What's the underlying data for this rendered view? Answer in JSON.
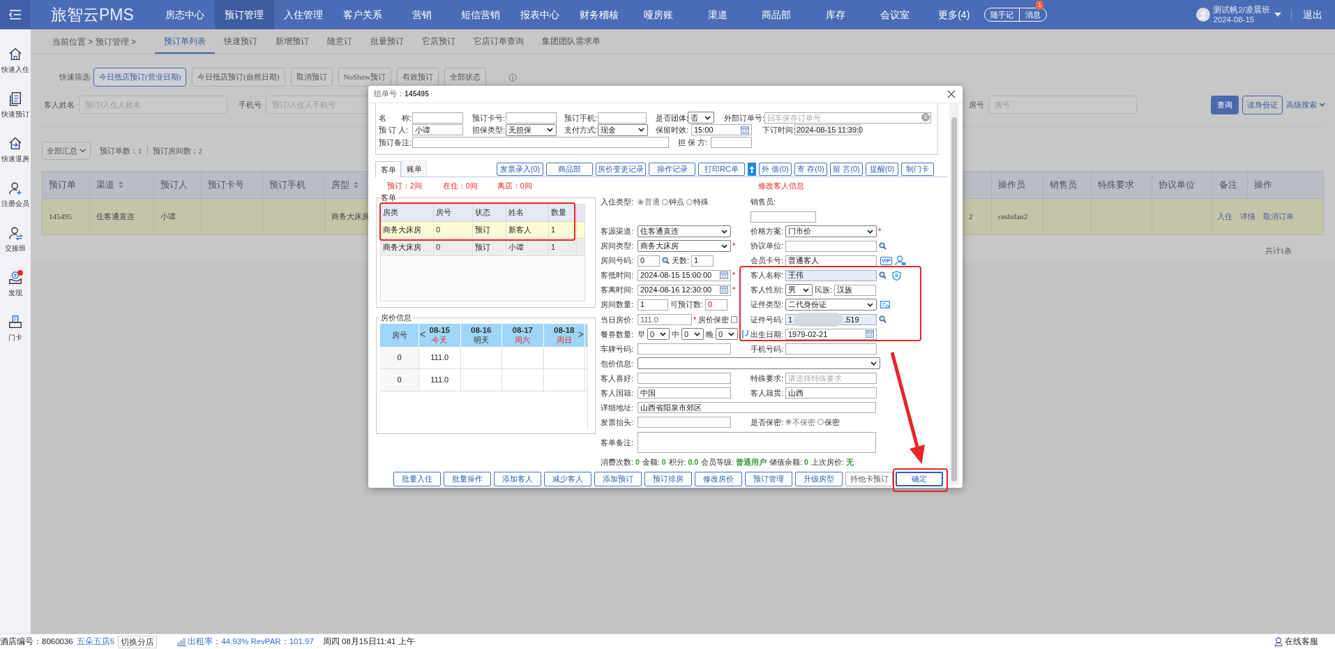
{
  "nav": {
    "logo": "旅智云PMS",
    "items": [
      {
        "label": "房态中心",
        "selected": false
      },
      {
        "label": "预订管理",
        "selected": true
      },
      {
        "label": "入住管理",
        "selected": false
      },
      {
        "label": "客户关系",
        "selected": false
      },
      {
        "label": "营销",
        "selected": false
      },
      {
        "label": "短信营销",
        "selected": false
      },
      {
        "label": "报表中心",
        "selected": false
      },
      {
        "label": "财务稽核",
        "selected": false
      },
      {
        "label": "哑房账",
        "selected": false
      },
      {
        "label": "渠道",
        "selected": false
      },
      {
        "label": "商品部",
        "selected": false
      },
      {
        "label": "库存",
        "selected": false
      },
      {
        "label": "会议室",
        "selected": false
      },
      {
        "label": "更多(4)",
        "selected": false
      }
    ],
    "quick_buttons": [
      "随手记",
      "消息"
    ],
    "message_badge": "1",
    "user": "测试帆2/凌晨班",
    "date": "2024-08-15",
    "logout": "退出"
  },
  "sidebar": [
    {
      "label": "快速入住",
      "kind": "home",
      "dot": false
    },
    {
      "label": "快速预订",
      "kind": "doc",
      "dot": false
    },
    {
      "label": "快速退房",
      "kind": "checkout",
      "dot": false
    },
    {
      "label": "注册会员",
      "kind": "useradd",
      "dot": false
    },
    {
      "label": "交接班",
      "kind": "userswap",
      "dot": false
    },
    {
      "label": "发现",
      "kind": "discover",
      "dot": true
    },
    {
      "label": "门卡",
      "kind": "card",
      "dot": false
    }
  ],
  "breadcrumb": "当前位置 > 预订管理 >",
  "page_tabs": [
    {
      "label": "预订单列表",
      "selected": true
    },
    {
      "label": "快速预订",
      "selected": false
    },
    {
      "label": "新增预订",
      "selected": false
    },
    {
      "label": "随意订",
      "selected": false
    },
    {
      "label": "批量预订",
      "selected": false
    },
    {
      "label": "它店预订",
      "selected": false
    },
    {
      "label": "它店订单查询",
      "selected": false
    },
    {
      "label": "集团团队需求单",
      "selected": false
    }
  ],
  "filters": {
    "label": "快速筛选",
    "buttons": [
      {
        "label": "今日抵店预订(营业日期)",
        "selected": true
      },
      {
        "label": "今日抵店预订(自然日期)",
        "selected": false
      },
      {
        "label": "取消预订",
        "selected": false
      },
      {
        "label": "NoShow预订",
        "selected": false
      },
      {
        "label": "有效预订",
        "selected": false
      },
      {
        "label": "全部状态",
        "selected": false
      }
    ]
  },
  "search": {
    "left_fields": [
      {
        "label": "客人姓名",
        "placeholder": "预订/入住人姓名"
      },
      {
        "label": "手机号",
        "placeholder": "预订/入住人手机号"
      }
    ],
    "right_fields": [
      {
        "label": "房号",
        "placeholder": "房号"
      }
    ],
    "query": "查询",
    "read_id": "读身份证",
    "advanced": "高级搜索"
  },
  "summary": {
    "scope": "全部汇总",
    "order_count": "预订单数：1",
    "room_count": "预订房间数：2"
  },
  "table": {
    "columns": [
      {
        "label": "预订单",
        "sortable": false
      },
      {
        "label": "渠道",
        "sortable": true
      },
      {
        "label": "预订人",
        "sortable": false
      },
      {
        "label": "预订卡号",
        "sortable": false
      },
      {
        "label": "预订手机",
        "sortable": false
      },
      {
        "label": "房型",
        "sortable": true
      }
    ],
    "right_columns": [
      "操作员",
      "销售员",
      "特殊要求",
      "协议单位",
      "备注",
      "操作"
    ],
    "rows": [
      {
        "selected": true,
        "cells": [
          "145495",
          "住客通直连",
          "小谭",
          null,
          null,
          "商务大床房"
        ],
        "right_cells": [
          "2",
          "ceshifan2",
          null,
          null,
          null
        ],
        "actions": [
          "入住",
          "详情",
          "取消订单"
        ]
      }
    ],
    "footer": "共计1条"
  },
  "dialog": {
    "title": "组单号：",
    "order_no": "145495",
    "order_rows": [
      [
        {
          "label": "名　　称:",
          "kind": "text"
        },
        {
          "label": "预订卡号:",
          "kind": "text"
        },
        {
          "label": "预订手机:",
          "kind": "text"
        },
        {
          "label": "是否团体:",
          "kind": "select",
          "value": "否"
        },
        {
          "label": "外部订单号:",
          "kind": "text",
          "placeholder": "回车保存订单号",
          "badge": "0"
        }
      ],
      [
        {
          "label": "预 订 人:",
          "kind": "text",
          "value": "小谭"
        },
        {
          "label": "担保类型:",
          "kind": "select",
          "value": "无担保"
        },
        {
          "label": "支付方式:",
          "kind": "select",
          "value": "现金"
        },
        {
          "label": "保留时效:",
          "kind": "date",
          "value": "15:00"
        },
        {
          "label": "下订时间:",
          "kind": "readonly",
          "value": "2024-08-15 11:39:0"
        }
      ],
      [
        {
          "label": "预订备注:",
          "kind": "text"
        },
        {
          "label": "担 保 方:",
          "kind": "text"
        }
      ]
    ],
    "tabs": [
      {
        "label": "客单",
        "selected": true
      },
      {
        "label": "账单",
        "selected": false
      }
    ],
    "actions": [
      {
        "kind": "button",
        "label": "发票录入(0)"
      },
      {
        "kind": "button",
        "label": "商品部"
      },
      {
        "kind": "button",
        "label": "房价变更记录"
      },
      {
        "kind": "button",
        "label": "操作记录"
      },
      {
        "kind": "button",
        "label": "打印RC单"
      },
      {
        "kind": "upload"
      },
      {
        "kind": "small",
        "label": "外 借(0)"
      },
      {
        "kind": "small",
        "label": "寄 存(0)"
      },
      {
        "kind": "small",
        "label": "留 言(0)"
      },
      {
        "kind": "small",
        "label": "提醒(0)"
      },
      {
        "kind": "small",
        "label": "制门卡"
      }
    ],
    "counts": [
      "预订：2间",
      "在住：0间",
      "离店：0间"
    ],
    "edit_title": "修改客人信息",
    "guests": {
      "legend": "客单",
      "columns": [
        "房类",
        "房号",
        "状态",
        "姓名",
        "数量"
      ],
      "rows": [
        {
          "selected": true,
          "cells": [
            "商务大床房",
            "0",
            "预订",
            "新客人",
            "1"
          ]
        },
        {
          "selected": false,
          "cells": [
            "商务大床房",
            "0",
            "预订",
            "小谭",
            "1"
          ]
        }
      ]
    },
    "prices": {
      "legend": "房价信息",
      "room_header": "房号",
      "prev": "<",
      "next": ">",
      "days": [
        {
          "date": "08-15",
          "day": "今天",
          "holiday": true
        },
        {
          "date": "08-16",
          "day": "明天",
          "holiday": false
        },
        {
          "date": "08-17",
          "day": "周六",
          "holiday": true
        },
        {
          "date": "08-18",
          "day": "周日",
          "holiday": true
        }
      ],
      "rows": [
        {
          "room": "0",
          "price": "111.0"
        },
        {
          "room": "0",
          "price": "111.0"
        }
      ]
    },
    "guest_form": [
      {
        "left": [
          {
            "kind": "label",
            "text": "入住类型:"
          },
          {
            "kind": "radio",
            "text": "普通",
            "checked": true,
            "disabled": true
          },
          {
            "kind": "radio",
            "text": "钟点",
            "checked": false,
            "disabled": false
          },
          {
            "kind": "radio",
            "text": "特殊",
            "checked": false,
            "disabled": false
          }
        ],
        "right": [
          {
            "kind": "label",
            "text": "销售员:"
          }
        ]
      },
      {
        "right": [
          {
            "kind": "box"
          }
        ]
      },
      {
        "left": [
          {
            "kind": "label",
            "text": "客源渠道:"
          },
          {
            "kind": "select",
            "value": "住客通直连"
          }
        ],
        "right": [
          {
            "kind": "label",
            "text": "价格方案:"
          },
          {
            "kind": "select",
            "value": "门市价"
          },
          {
            "kind": "mark",
            "text": "*"
          }
        ]
      },
      {
        "left": [
          {
            "kind": "label",
            "text": "房间类型:"
          },
          {
            "kind": "select",
            "value": "商务大床房"
          },
          {
            "kind": "mark",
            "text": "*"
          }
        ],
        "right": [
          {
            "kind": "label",
            "text": "协议单位:"
          },
          {
            "kind": "input"
          },
          {
            "kind": "lookup"
          }
        ]
      },
      {
        "left": [
          {
            "kind": "label",
            "text": "房间号码:"
          },
          {
            "kind": "short",
            "value": "0"
          },
          {
            "kind": "lookup"
          },
          {
            "kind": "label",
            "text": "天数:"
          },
          {
            "kind": "short",
            "value": "1"
          }
        ],
        "right": [
          {
            "kind": "label",
            "text": "会员卡号:"
          },
          {
            "kind": "input",
            "value": "普通客人"
          },
          {
            "kind": "vip",
            "text": "VIP"
          },
          {
            "kind": "member"
          }
        ]
      },
      {
        "left": [
          {
            "kind": "label",
            "text": "客抵时间:"
          },
          {
            "kind": "date",
            "value": "2024-08-15 15:00:00"
          },
          {
            "kind": "mark",
            "text": "*"
          }
        ],
        "right": [
          {
            "kind": "label",
            "text": "客人名称:"
          },
          {
            "kind": "input",
            "value": "王伟",
            "highlighted": true
          },
          {
            "kind": "lookup"
          },
          {
            "kind": "verify"
          }
        ]
      },
      {
        "left": [
          {
            "kind": "label",
            "text": "客离时间:"
          },
          {
            "kind": "date",
            "value": "2024-08-16 12:30:00"
          },
          {
            "kind": "mark",
            "text": "*"
          }
        ],
        "right": [
          {
            "kind": "label",
            "text": "客人性别:"
          },
          {
            "kind": "tiny-select",
            "value": "男"
          },
          {
            "kind": "label",
            "text": "民族:"
          },
          {
            "kind": "small",
            "value": "汉族"
          }
        ]
      },
      {
        "left": [
          {
            "kind": "label",
            "text": "房间数量:"
          },
          {
            "kind": "small",
            "value": "1"
          },
          {
            "kind": "label",
            "text": "可预订数:"
          },
          {
            "kind": "short",
            "value": "0",
            "alert": true
          }
        ],
        "right": [
          {
            "kind": "label",
            "text": "证件类型:"
          },
          {
            "kind": "select",
            "value": "二代身份证"
          },
          {
            "kind": "scan"
          }
        ]
      },
      {
        "left": [
          {
            "kind": "label",
            "text": "当日房价:"
          },
          {
            "kind": "medium",
            "value": "111.0",
            "disabled": true
          },
          {
            "kind": "mark",
            "text": "*"
          },
          {
            "kind": "label",
            "text": "房价保密"
          },
          {
            "kind": "check",
            "checked": false
          }
        ],
        "right": [
          {
            "kind": "label",
            "text": "证件号码:"
          },
          {
            "kind": "masked",
            "prefix": "1",
            "suffix": ".519",
            "highlighted": true
          },
          {
            "kind": "lookup"
          }
        ]
      },
      {
        "left": [
          {
            "kind": "label",
            "text": "餐券数量:"
          },
          {
            "kind": "label",
            "text": "早"
          },
          {
            "kind": "tiny-select",
            "value": "0"
          },
          {
            "kind": "label",
            "text": "中"
          },
          {
            "kind": "tiny-select",
            "value": "0"
          },
          {
            "kind": "label",
            "text": "晚"
          },
          {
            "kind": "tiny-select",
            "value": "0"
          },
          {
            "kind": "meal"
          }
        ],
        "right": [
          {
            "kind": "label",
            "text": "出生日期:"
          },
          {
            "kind": "date",
            "value": "1979-02-21"
          }
        ]
      },
      {
        "left": [
          {
            "kind": "label",
            "text": "车牌号码:"
          },
          {
            "kind": "input"
          }
        ],
        "right": [
          {
            "kind": "label",
            "text": "手机号码:"
          },
          {
            "kind": "input"
          }
        ]
      },
      {
        "left": [
          {
            "kind": "label",
            "text": "包价信息:"
          },
          {
            "kind": "wide-select"
          }
        ]
      },
      {
        "left": [
          {
            "kind": "label",
            "text": "客人喜好:"
          },
          {
            "kind": "input"
          }
        ],
        "right": [
          {
            "kind": "label",
            "text": "特殊要求:"
          },
          {
            "kind": "input",
            "placeholder": "请选择特殊要求"
          }
        ]
      },
      {
        "left": [
          {
            "kind": "label",
            "text": "客人国籍:"
          },
          {
            "kind": "input",
            "value": "中国"
          }
        ],
        "right": [
          {
            "kind": "label",
            "text": "客人籍贯:"
          },
          {
            "kind": "input",
            "value": "山西"
          }
        ]
      },
      {
        "left": [
          {
            "kind": "label",
            "text": "详细地址:"
          },
          {
            "kind": "wide",
            "value": "山西省阳泉市郊区"
          }
        ]
      },
      {
        "left": [
          {
            "kind": "label",
            "text": "发票抬头:"
          },
          {
            "kind": "input"
          }
        ],
        "right": [
          {
            "kind": "label",
            "text": "是否保密:"
          },
          {
            "kind": "radio",
            "text": "不保密",
            "checked": true,
            "disabled": true
          },
          {
            "kind": "radio",
            "text": "保密",
            "checked": false,
            "disabled": false
          }
        ]
      },
      {
        "left": [
          {
            "kind": "label",
            "text": "客单备注:"
          },
          {
            "kind": "textarea"
          }
        ]
      }
    ],
    "stats": [
      {
        "label": "消费次数:",
        "value": "0"
      },
      {
        "label": "金额:",
        "value": "0"
      },
      {
        "label": "积分:",
        "value": "0.0"
      },
      {
        "label": "会员等级:",
        "value": "普通用户"
      },
      {
        "label": "储值余额:",
        "value": "0"
      },
      {
        "label": "上次房价:",
        "value": "无"
      }
    ],
    "buttons": [
      {
        "label": "批量入住",
        "disabled": false,
        "focused": false
      },
      {
        "label": "批量操作",
        "disabled": false,
        "focused": false
      },
      {
        "label": "添加客人",
        "disabled": false,
        "focused": false
      },
      {
        "label": "减少客人",
        "disabled": false,
        "focused": false
      },
      {
        "label": "添加预订",
        "disabled": false,
        "focused": false
      },
      {
        "label": "预订排房",
        "disabled": false,
        "focused": false
      },
      {
        "label": "修改房价",
        "disabled": false,
        "focused": false
      },
      {
        "label": "预订管理",
        "disabled": false,
        "focused": false
      },
      {
        "label": "升级房型",
        "disabled": false,
        "focused": false
      },
      {
        "label": "持他卡预订",
        "disabled": true,
        "focused": false
      },
      {
        "label": "确定",
        "disabled": false,
        "focused": true
      }
    ]
  },
  "status_bar": {
    "hotel_label": "酒店编号：8060036",
    "hotel_name": "五朵五店5",
    "switch": "切换分店",
    "occupancy": "出租率：44.93% RevPAR：101.97",
    "datetime": "周四 08月15日11:41 上午",
    "support": "在线客服"
  }
}
